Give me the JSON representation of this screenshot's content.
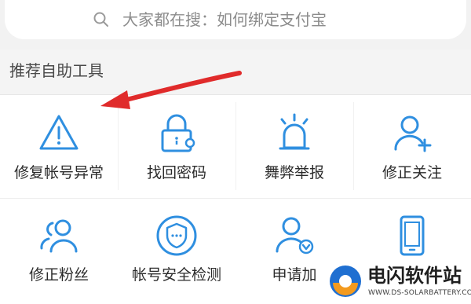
{
  "search": {
    "icon": "search-icon",
    "placeholder": "大家都在搜：如何绑定支付宝"
  },
  "section": {
    "title": "推荐自助工具"
  },
  "tools": [
    {
      "label": "修复帐号异常",
      "icon": "warning-triangle-icon"
    },
    {
      "label": "找回密码",
      "icon": "lock-icon"
    },
    {
      "label": "舞弊举报",
      "icon": "alarm-siren-icon"
    },
    {
      "label": "修正关注",
      "icon": "user-add-icon"
    },
    {
      "label": "修正粉丝",
      "icon": "users-group-icon"
    },
    {
      "label": "帐号安全检测",
      "icon": "shield-icon"
    },
    {
      "label": "申请加",
      "icon": "user-verified-icon"
    },
    {
      "label": "",
      "icon": "phone-icon"
    }
  ],
  "annotation": {
    "icon": "red-arrow-icon"
  },
  "watermark": {
    "name": "电闪软件站",
    "url": "WWW.DS-SOLARBATTERY.COM"
  },
  "colors": {
    "accent": "#2f8fe0",
    "arrow": "#e02b2b",
    "page_bg": "#f3f3f3"
  }
}
